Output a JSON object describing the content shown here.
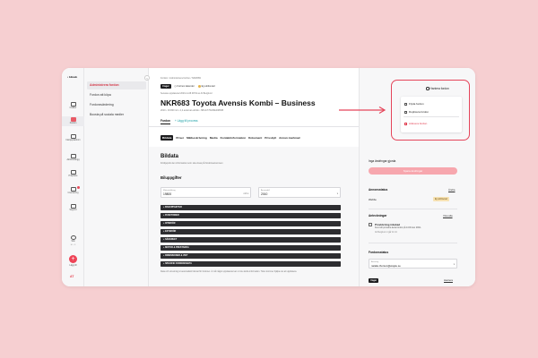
{
  "rail": {
    "brand": "• bilweb",
    "items": [
      {
        "label": "Insikter",
        "icon": "lightbulb-icon"
      },
      {
        "label": "Fordon",
        "icon": "car-icon",
        "active": true
      },
      {
        "label": "Inköpsplattform",
        "icon": "grid-icon"
      },
      {
        "label": "Aktivitetslogg",
        "icon": "box-icon"
      },
      {
        "label": "Prisplane",
        "icon": "chart-icon"
      },
      {
        "label": "Inventering",
        "icon": "briefcase-icon"
      },
      {
        "label": "Support",
        "icon": "support-icon"
      },
      {
        "label": "Sök",
        "icon": "search-icon"
      }
    ],
    "search_shortcut": "⌘ + K",
    "add_label": "Lägg till",
    "user_initials": "AT"
  },
  "submenu": {
    "items": [
      "Administrera fordon",
      "Fordon att köpa",
      "Fordonsvärdering",
      "Boosta på sociala medier"
    ],
    "active_index": 0
  },
  "vehicle": {
    "breadcrumb": "Fordon  /  Administrera fordon  /  NKR683",
    "status_tag": "I lager",
    "tag_pending": "Fortnox kalender",
    "tag_warning": "Ej publicerad",
    "meta": "Senaste uppdaterad 2023-11-08 08:54 av Ali Berglund",
    "title": "NKR683 Toyota Avensis Kombi – Business",
    "specs": "2010  •  19 800 mil  •  2,2 automat ektrisk  •  SB1GT76L80E038365",
    "tab_main": "Fordon",
    "tab_add": "+ Lägg till process",
    "subtabs": [
      "Bildata",
      "Priser",
      "Mätbeskrivning",
      "Media",
      "Kontaktinformation",
      "Dokument",
      "Prisskylt",
      "Annan marknad"
    ]
  },
  "bildata": {
    "title": "Bildata",
    "description": "Fördjupnik den information som ska visas på fordonsannonsen",
    "subsection": "Biluppgifter",
    "mileage_label": "Mätarställning",
    "mileage_value": "19800",
    "mileage_unit": "mil",
    "year_label": "Årsmodell",
    "year_value": "2010",
    "accordions": [
      "BASUPPGIFTER",
      "FUNKTIONER",
      "INTERIÖR",
      "EXTERIÖR",
      "SÄKERHET",
      "MOTOR & PRESTANDA",
      "DIMENSIONER & VIKT",
      "SPECIFIK FORDONSDATA"
    ],
    "footnote": "Data och utrustning är automatiskt hämtat för fordonet. Är nåt något uppdateras kan vi inte ändra information. Tiden kommer hjälpa oss att uppdatera."
  },
  "panel": {
    "manage_button": "Hantera fordon",
    "menu": [
      "Flytta fordon",
      "Duplicera fordon",
      "Arkivera fordon"
    ],
    "changes_label": "Inga ändringar gjorda",
    "save_button": "Spara ändringar",
    "ad_status_label": "Annonsstatus",
    "ad_status_link": "Ändra",
    "channel": "Webbe",
    "status_pill": "Ej publicerad",
    "notes_label": "Anteckningar",
    "notes_link": "Visa alla",
    "note_title": "Provkörning inbokad",
    "note_body": "Kund vill provköra detta fordon på 14:00 den 29/11.",
    "note_author": "Ali Berglund  •  Igår 11:44",
    "vehicle_status_label": "Fordonsstatus",
    "assignee_label": "Ansvarig",
    "assignee_value": "natalie.thorson@wayke.se",
    "bottom_tag": "I lager",
    "bottom_link": "Hantera"
  },
  "colors": {
    "accent": "#e5455a",
    "background": "#f6cfd1"
  }
}
